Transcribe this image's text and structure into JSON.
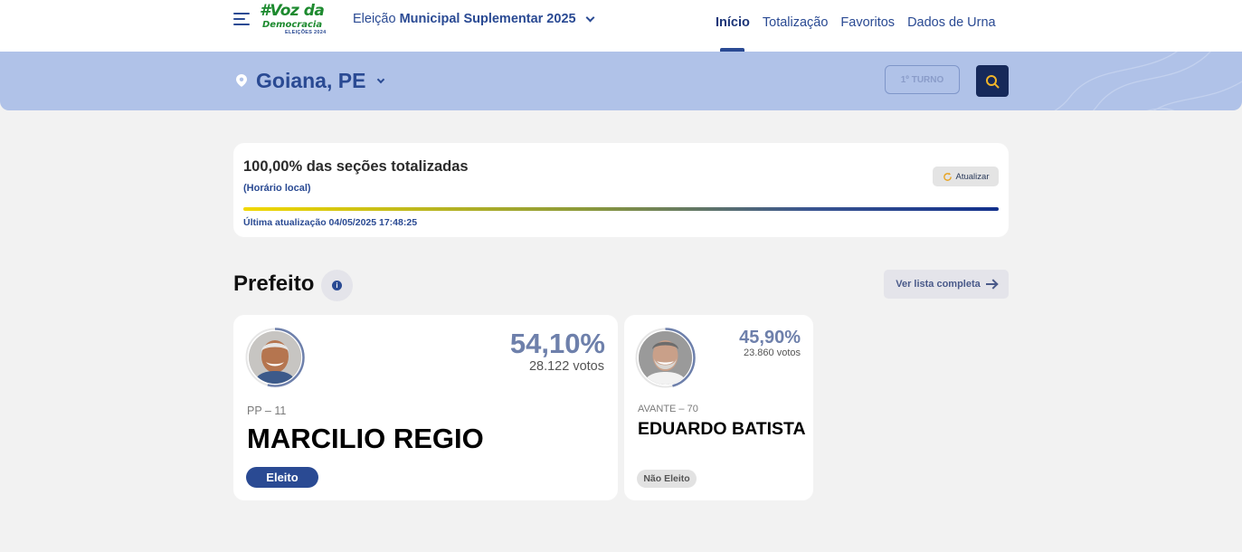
{
  "header": {
    "logo_main": "#Voz da",
    "logo_sub": "Democracia",
    "logo_year": "ELEIÇÕES 2024",
    "election_prefix": "Eleição",
    "election_name": "Municipal Suplementar 2025",
    "nav": [
      "Início",
      "Totalização",
      "Favoritos",
      "Dados de Urna"
    ]
  },
  "location": {
    "name": "Goiana, PE",
    "turno_label": "1º TURNO"
  },
  "status": {
    "title": "100,00% das seções totalizadas",
    "subtitle": "(Horário local)",
    "refresh_label": "Atualizar",
    "progress": 1.0,
    "updated": "Última atualização 04/05/2025 17:48:25"
  },
  "section": {
    "title": "Prefeito",
    "info_icon": "i",
    "full_list_label": "Ver lista completa"
  },
  "candidates": [
    {
      "percent": "54,10%",
      "votes": "28.122 votos",
      "party": "PP – 11",
      "name": "MARCILIO REGIO",
      "status": "Eleito",
      "ring_fraction": 0.541
    },
    {
      "percent": "45,90%",
      "votes": "23.860 votos",
      "party": "AVANTE – 70",
      "name": "EDUARDO BATISTA",
      "status": "Não Eleito",
      "ring_fraction": 0.459
    }
  ],
  "colors": {
    "brand_blue": "#2a4a93",
    "location_bar": "#b0c2e8",
    "search_button": "#16295a",
    "logo_green": "#1d8a2f",
    "percent_text": "#6e80ab"
  }
}
